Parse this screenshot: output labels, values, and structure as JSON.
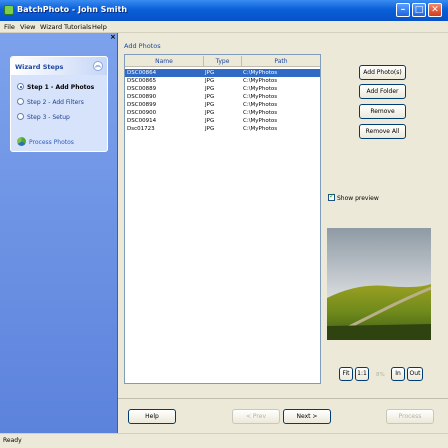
{
  "window": {
    "title": "BatchPhoto - John Smith"
  },
  "menu": [
    "File",
    "View",
    "Wizard",
    "Tutorials",
    "Help"
  ],
  "wizard": {
    "title": "Wizard Steps",
    "steps": [
      {
        "label": "Step 1 - Add Photos",
        "active": true
      },
      {
        "label": "Step 2 - Add Filters",
        "active": false
      },
      {
        "label": "Step 3 - Setup",
        "active": false
      }
    ],
    "process_label": "Process Photos"
  },
  "add_photos": {
    "title": "Add Photos",
    "columns": [
      "Name",
      "Type",
      "Path"
    ],
    "rows": [
      [
        "DSC00864",
        "JPG",
        "C:\\MyPhotos"
      ],
      [
        "DSC00865",
        "JPG",
        "C:\\MyPhotos"
      ],
      [
        "DSC00889",
        "JPG",
        "C:\\MyPhotos"
      ],
      [
        "DSC00890",
        "JPG",
        "C:\\MyPhotos"
      ],
      [
        "DSC00899",
        "JPG",
        "C:\\MyPhotos"
      ],
      [
        "DSC00900",
        "JPG",
        "C:\\MyPhotos"
      ],
      [
        "DSC00914",
        "JPG",
        "C:\\MyPhotos"
      ],
      [
        "Dsc01723",
        "JPG",
        "C:\\MyPhotos"
      ]
    ]
  },
  "actions": {
    "add_photos": "Add Photo(s)",
    "add_folder": "Add Folder",
    "remove": "Remove",
    "remove_all": "Remove All"
  },
  "preview": {
    "show_label": "Show preview",
    "fit": "Fit",
    "one_to_one": "1:1",
    "zoom_pct": "8%",
    "zoom_in": "In",
    "zoom_out": "Out"
  },
  "nav": {
    "help": "Help",
    "prev": "< Prev",
    "next": "Next >",
    "process": "Process"
  },
  "status": "Ready"
}
